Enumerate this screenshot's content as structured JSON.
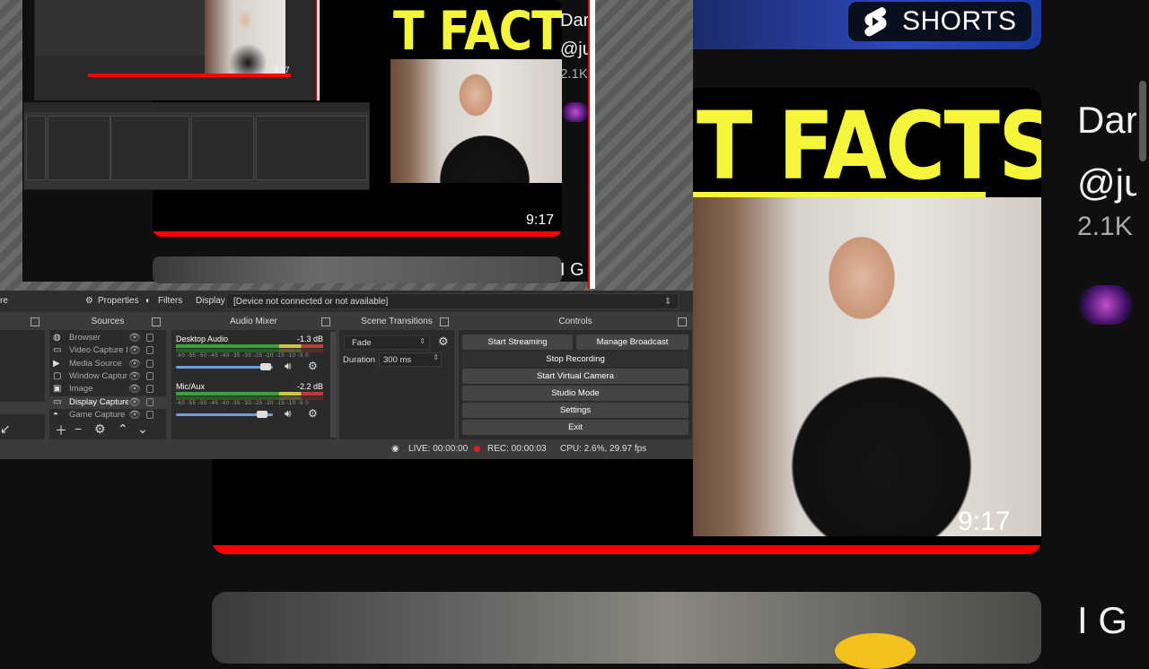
{
  "youtube": {
    "shorts_label": "SHORTS",
    "main_thumb_title": "T FACTS!",
    "main_duration": "9:17",
    "channel_name": "Dar",
    "channel_handle": "@ju",
    "channel_subs": "2.1K",
    "next_title": "I G",
    "brand_red": "#ff0000",
    "title_yellow": "#f5f53a"
  },
  "preview": {
    "thumb_title": "T FACTS!",
    "duration": "9:17",
    "channel_name": "Dar",
    "channel_handle": "@ju",
    "channel_subs": "2.1K",
    "next_title": "I G",
    "mini_duration": "9:17"
  },
  "toolbar": {
    "properties_label": "Properties",
    "filters_label": "Filters",
    "display_label": "Display",
    "device_value": "[Device not connected or not available]"
  },
  "sources": {
    "title": "Sources",
    "items": [
      {
        "label": "Browser",
        "icon": "globe-icon"
      },
      {
        "label": "Video Capture I",
        "icon": "camera-icon"
      },
      {
        "label": "Media Source",
        "icon": "play-icon"
      },
      {
        "label": "Window Captur",
        "icon": "window-icon"
      },
      {
        "label": "Image",
        "icon": "image-icon"
      },
      {
        "label": "Display Capture",
        "icon": "monitor-icon"
      },
      {
        "label": "Game Capture",
        "icon": "gamepad-icon"
      }
    ]
  },
  "mixer": {
    "title": "Audio Mixer",
    "channels": [
      {
        "name": "Desktop Audio",
        "db": "-1.3 dB"
      },
      {
        "name": "Mic/Aux",
        "db": "-2.2 dB"
      }
    ],
    "scale": "-60 -55 -50 -45 -40 -35 -30 -25 -20 -15 -10 -5 0"
  },
  "transitions": {
    "title": "Scene Transitions",
    "selected": "Fade",
    "duration_label": "Duration",
    "duration_value": "300 ms"
  },
  "controls": {
    "title": "Controls",
    "start_streaming": "Start Streaming",
    "manage_broadcast": "Manage Broadcast",
    "stop_recording": "Stop Recording",
    "start_virtual_camera": "Start Virtual Camera",
    "studio_mode": "Studio Mode",
    "settings": "Settings",
    "exit": "Exit"
  },
  "status": {
    "live": "LIVE: 00:00:00",
    "rec": "REC: 00:00:03",
    "cpu": "CPU: 2.6%, 29.97 fps"
  }
}
